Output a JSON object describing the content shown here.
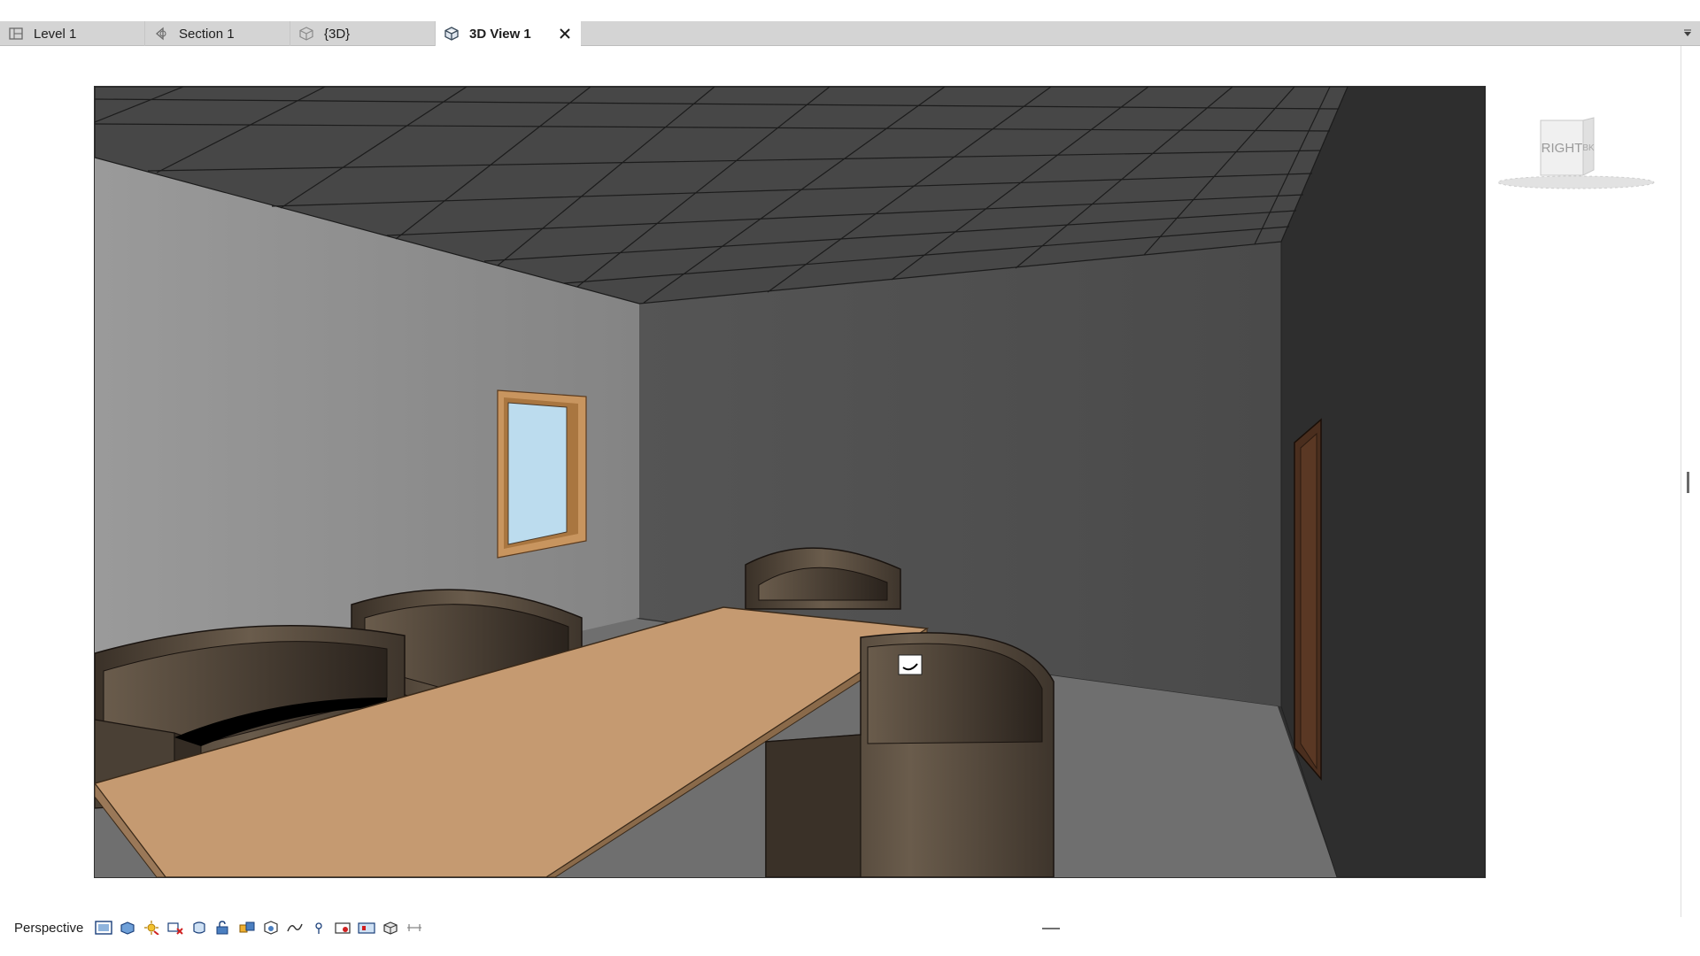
{
  "tabs": [
    {
      "label": "Level 1",
      "icon": "floor-plan-icon",
      "active": false
    },
    {
      "label": "Section 1",
      "icon": "section-view-icon",
      "active": false
    },
    {
      "label": "{3D}",
      "icon": "3d-view-icon",
      "active": false
    },
    {
      "label": "3D View 1",
      "icon": "3d-view-icon",
      "active": true
    }
  ],
  "viewcube": {
    "front_face_label": "RIGHT",
    "side_face_label": "BK"
  },
  "view_control_bar": {
    "view_mode": "Perspective",
    "tools": [
      "visual-style-icon",
      "shadows-icon",
      "sun-path-icon",
      "crop-view-icon",
      "show-crop-region-icon",
      "unlock-3d-view-icon",
      "temporary-hide-isolate-icon",
      "reveal-hidden-elements-icon",
      "worksharing-display-icon",
      "reveal-constraints-icon",
      "temporary-view-properties-icon",
      "render-icon",
      "highlight-displacement-icon",
      "analytical-model-icon"
    ]
  },
  "colors": {
    "tab_bar": "#d4d4d4",
    "ceiling": "#4a4a4a",
    "left_wall": "#8e8e8e",
    "back_wall": "#505050",
    "right_wall": "#2f2f2f",
    "floor": "#6e6e6e",
    "table_top": "#c59a71",
    "chair": "#4e4336",
    "window_glass": "#bcdcee",
    "window_frame": "#c8955f",
    "door": "#4a2e1e"
  }
}
